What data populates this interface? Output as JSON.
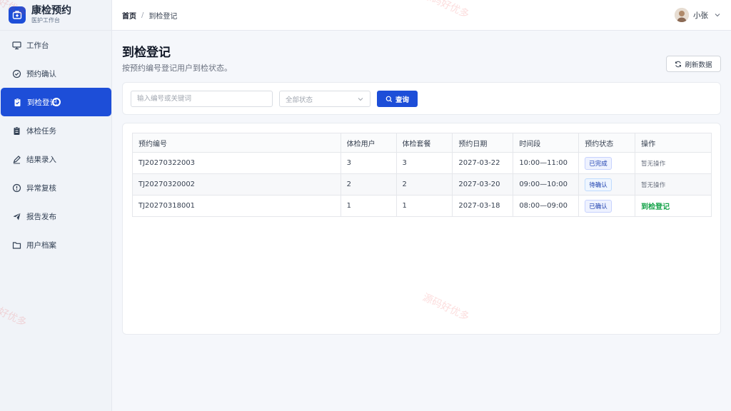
{
  "brand": {
    "title": "康检预约",
    "subtitle": "医护工作台"
  },
  "sidebar": {
    "items": [
      {
        "label": "工作台",
        "icon": "monitor-icon"
      },
      {
        "label": "预约确认",
        "icon": "check-circle-icon"
      },
      {
        "label": "到检登记",
        "icon": "clipboard-check-icon",
        "active": true
      },
      {
        "label": "体检任务",
        "icon": "clipboard-icon"
      },
      {
        "label": "结果录入",
        "icon": "pencil-icon"
      },
      {
        "label": "异常复核",
        "icon": "alert-circle-icon"
      },
      {
        "label": "报告发布",
        "icon": "send-icon"
      },
      {
        "label": "用户档案",
        "icon": "folder-icon"
      }
    ]
  },
  "breadcrumb": {
    "home": "首页",
    "separator": "/",
    "current": "到检登记"
  },
  "user": {
    "name": "小张"
  },
  "page": {
    "title": "到检登记",
    "subtitle": "按预约编号登记用户到检状态。"
  },
  "toolbar": {
    "refresh_label": "刷新数据"
  },
  "filter": {
    "search_placeholder": "输入编号或关键词",
    "status_selected": "全部状态",
    "query_label": "查询"
  },
  "table": {
    "headers": [
      "预约编号",
      "体检用户",
      "体检套餐",
      "预约日期",
      "时间段",
      "预约状态",
      "操作"
    ],
    "rows": [
      {
        "id": "TJ20270322003",
        "user": "3",
        "package": "3",
        "date": "2027-03-22",
        "slot": "10:00—11:00",
        "status": "已完成",
        "action": "暂无操作"
      },
      {
        "id": "TJ20270320002",
        "user": "2",
        "package": "2",
        "date": "2027-03-20",
        "slot": "09:00—10:00",
        "status": "待确认",
        "action": "暂无操作"
      },
      {
        "id": "TJ20270318001",
        "user": "1",
        "package": "1",
        "date": "2027-03-18",
        "slot": "08:00—09:00",
        "status": "已确认",
        "action": "到检登记"
      }
    ]
  },
  "watermark": "源码好优多",
  "colors": {
    "primary": "#1d4ed8",
    "success": "#16a34a",
    "sidebar_bg": "#f0f3f8"
  }
}
